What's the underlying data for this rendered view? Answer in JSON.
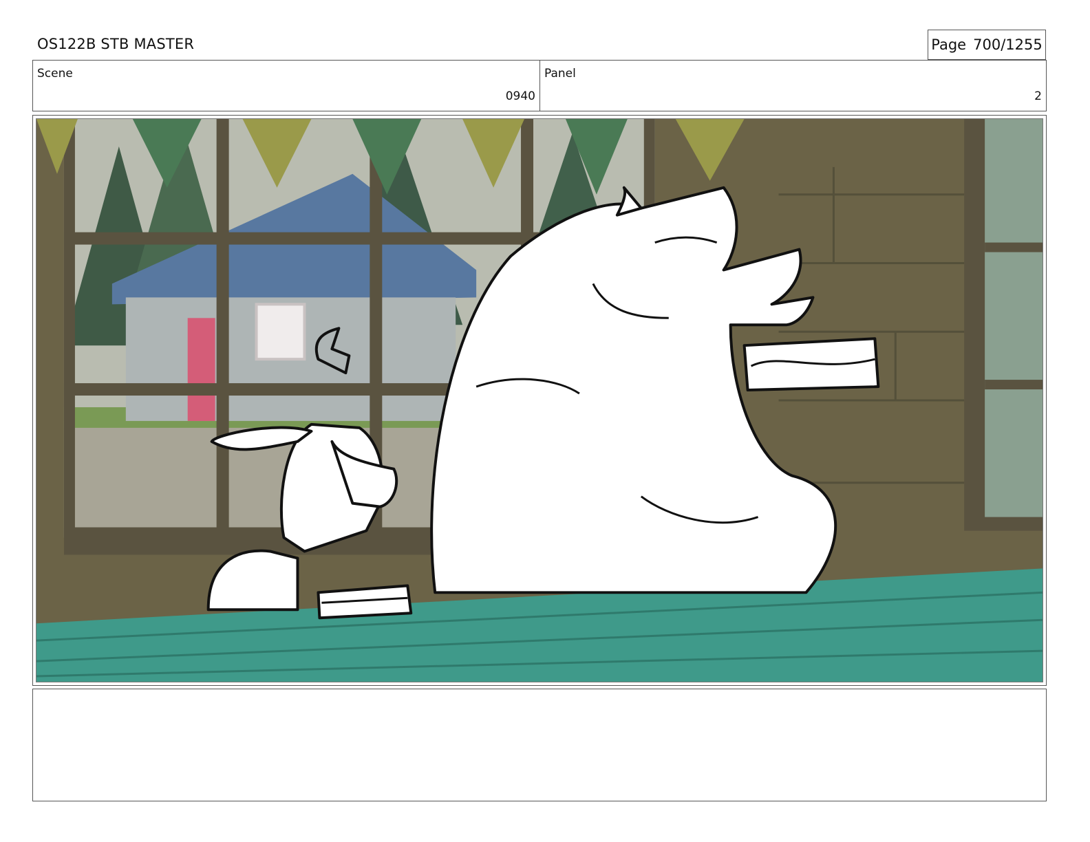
{
  "header": {
    "doc_title": "OS122B STB MASTER",
    "page_label": "Page",
    "page_number": "700/1255"
  },
  "scene": {
    "label": "Scene",
    "value": "0940"
  },
  "panel": {
    "label": "Panel",
    "value": "2"
  },
  "notes": {
    "text": ""
  },
  "colors": {
    "wall_brown": "#6b6347",
    "table_teal": "#3f9a8a",
    "window_frame": "#5a5340",
    "pennant_green": "#4a7a55",
    "pennant_yellow": "#9a9a4a",
    "cabin_roof": "#5878a0"
  }
}
